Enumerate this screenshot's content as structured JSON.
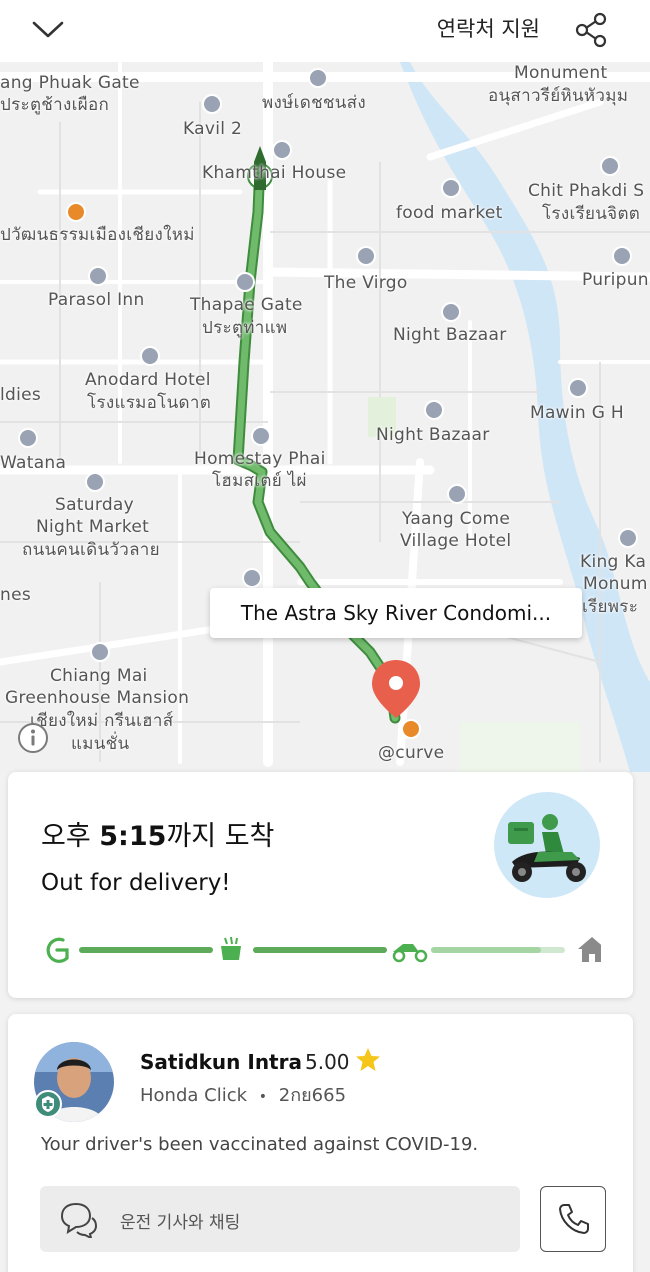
{
  "header": {
    "support_label": "연락처 지원"
  },
  "map": {
    "labels": [
      {
        "id": "lbl-phuak-gate",
        "text": "ang Phuak Gate"
      },
      {
        "id": "lbl-phuak-gate-th",
        "text": "ประตูช้างเผือก"
      },
      {
        "id": "lbl-kavil",
        "text": "Kavil 2"
      },
      {
        "id": "lbl-temple-th",
        "text": "พงษ์เดชชนส่ง"
      },
      {
        "id": "lbl-monument",
        "text": "Monument"
      },
      {
        "id": "lbl-monument-th",
        "text": "อนุสาวรีย์หินหัวมุม"
      },
      {
        "id": "lbl-khamthai",
        "text": "Khamthai House"
      },
      {
        "id": "lbl-chit-phakdi",
        "text": "Chit Phakdi S"
      },
      {
        "id": "lbl-chit-phakdi-th",
        "text": "โรงเรียนจิตต"
      },
      {
        "id": "lbl-food-market",
        "text": "food market"
      },
      {
        "id": "lbl-museum-th",
        "text": "ปวัฒนธรรมเมืองเชียงใหม่"
      },
      {
        "id": "lbl-puripun",
        "text": "Puripun"
      },
      {
        "id": "lbl-virgo",
        "text": "The Virgo"
      },
      {
        "id": "lbl-parasol",
        "text": "Parasol Inn"
      },
      {
        "id": "lbl-thapae",
        "text": "Thapae Gate"
      },
      {
        "id": "lbl-thapae-th",
        "text": "ประตูท่าแพ"
      },
      {
        "id": "lbl-night-bazaar-1",
        "text": "Night Bazaar"
      },
      {
        "id": "lbl-anodard",
        "text": "Anodard Hotel"
      },
      {
        "id": "lbl-anodard-th",
        "text": "โรงแรมอโนดาต"
      },
      {
        "id": "lbl-ldies",
        "text": "ldies"
      },
      {
        "id": "lbl-mawin",
        "text": "Mawin G H"
      },
      {
        "id": "lbl-night-bazaar-2",
        "text": "Night Bazaar"
      },
      {
        "id": "lbl-watana",
        "text": "Watana"
      },
      {
        "id": "lbl-homestay",
        "text": "Homestay Phai"
      },
      {
        "id": "lbl-homestay-th",
        "text": "โฮมสเตย์ ไผ่"
      },
      {
        "id": "lbl-saturday-1",
        "text": "Saturday"
      },
      {
        "id": "lbl-saturday-2",
        "text": "Night Market"
      },
      {
        "id": "lbl-saturday-th",
        "text": "ถนนคนเดินวัวลาย"
      },
      {
        "id": "lbl-yaang-1",
        "text": "Yaang Come"
      },
      {
        "id": "lbl-yaang-2",
        "text": "Village Hotel"
      },
      {
        "id": "lbl-king-1",
        "text": "King Ka"
      },
      {
        "id": "lbl-king-2",
        "text": "Monum"
      },
      {
        "id": "lbl-king-th",
        "text": "เรียพระ"
      },
      {
        "id": "lbl-nes",
        "text": "nes"
      },
      {
        "id": "lbl-chiangmai-1",
        "text": "Chiang Mai"
      },
      {
        "id": "lbl-chiangmai-2",
        "text": "Greenhouse Mansion"
      },
      {
        "id": "lbl-chiangmai-th-1",
        "text": "เชียงใหม่ กรีนเฮาส์"
      },
      {
        "id": "lbl-chiangmai-th-2",
        "text": "แมนชั่น"
      },
      {
        "id": "lbl-curve",
        "text": "@curve"
      }
    ],
    "destination_callout": "The Astra Sky River Condomi..."
  },
  "eta": {
    "prefix": "오후 ",
    "time": "5:15",
    "suffix": "까지 도착",
    "status": "Out for delivery!"
  },
  "driver": {
    "name": "Satidkun Intra",
    "rating": "5.00",
    "vehicle": "Honda Click",
    "separator": "•",
    "plate": "2กย665",
    "vaccination_note": "Your driver's been vaccinated against COVID-19.",
    "chat_label": "운전 기사와 채팅"
  },
  "colors": {
    "brand_green": "#4caf50",
    "route_green": "#5daa5b",
    "pin_red": "#e8604c",
    "river_blue": "#cfe6f7",
    "star_yellow": "#f5c518"
  },
  "icons": {
    "back": "chevron-down-icon",
    "share": "share-icon",
    "info": "info-icon",
    "chat": "chat-bubbles-icon",
    "call": "phone-icon",
    "star": "star-icon"
  }
}
